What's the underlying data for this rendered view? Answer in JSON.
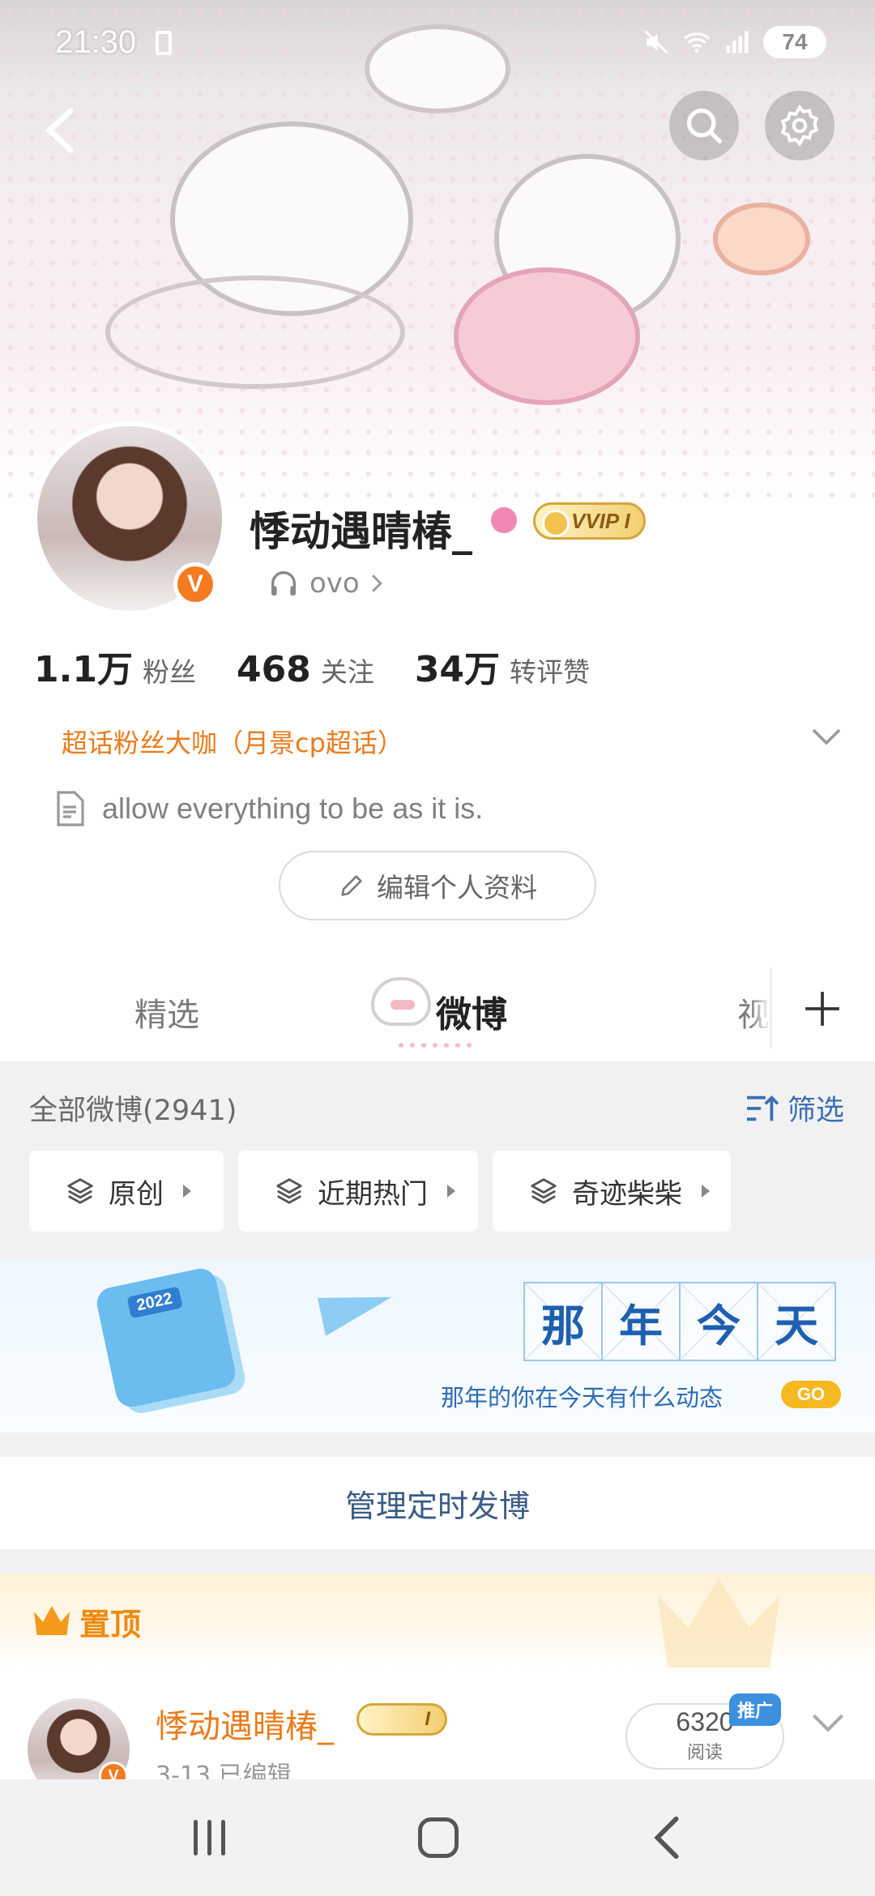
{
  "status_bar": {
    "time": "21:30",
    "battery": "74"
  },
  "profile": {
    "username": "悸动遇晴椿_",
    "vip_badge": "VVIP I",
    "verified_badge": "V",
    "music_text": "ovo",
    "stats": [
      {
        "value": "1.1万",
        "label": "粉丝"
      },
      {
        "value": "468",
        "label": "关注"
      },
      {
        "value": "34万",
        "label": "转评赞"
      }
    ],
    "fan_tag": "超话粉丝大咖（月景cp超话）",
    "bio": "allow everything to be as it is.",
    "edit_button": "编辑个人资料"
  },
  "tabs": {
    "items": [
      "精选",
      "微博",
      "视"
    ],
    "active": "微博"
  },
  "feed": {
    "all_title": "全部微博(2941)",
    "filter_label": "筛选",
    "chips": [
      "原创",
      "近期热门",
      "奇迹柴柴"
    ]
  },
  "on_this_day": {
    "calendar_year": "2022",
    "title_chars": [
      "那",
      "年",
      "今",
      "天"
    ],
    "subtitle": "那年的你在今天有什么动态",
    "go_label": "GO"
  },
  "manage_label": "管理定时发博",
  "pinned": {
    "label": "置顶",
    "post": {
      "author": "悸动遇晴椿_",
      "vip_badge": "I",
      "meta": "3-13 已编辑",
      "reads_count": "6320",
      "reads_label": "阅读",
      "promo_label": "推广"
    }
  },
  "colors": {
    "accent_orange": "#ea7b1a",
    "link_blue": "#3b6fb4",
    "verified_orange": "#f47b20"
  }
}
